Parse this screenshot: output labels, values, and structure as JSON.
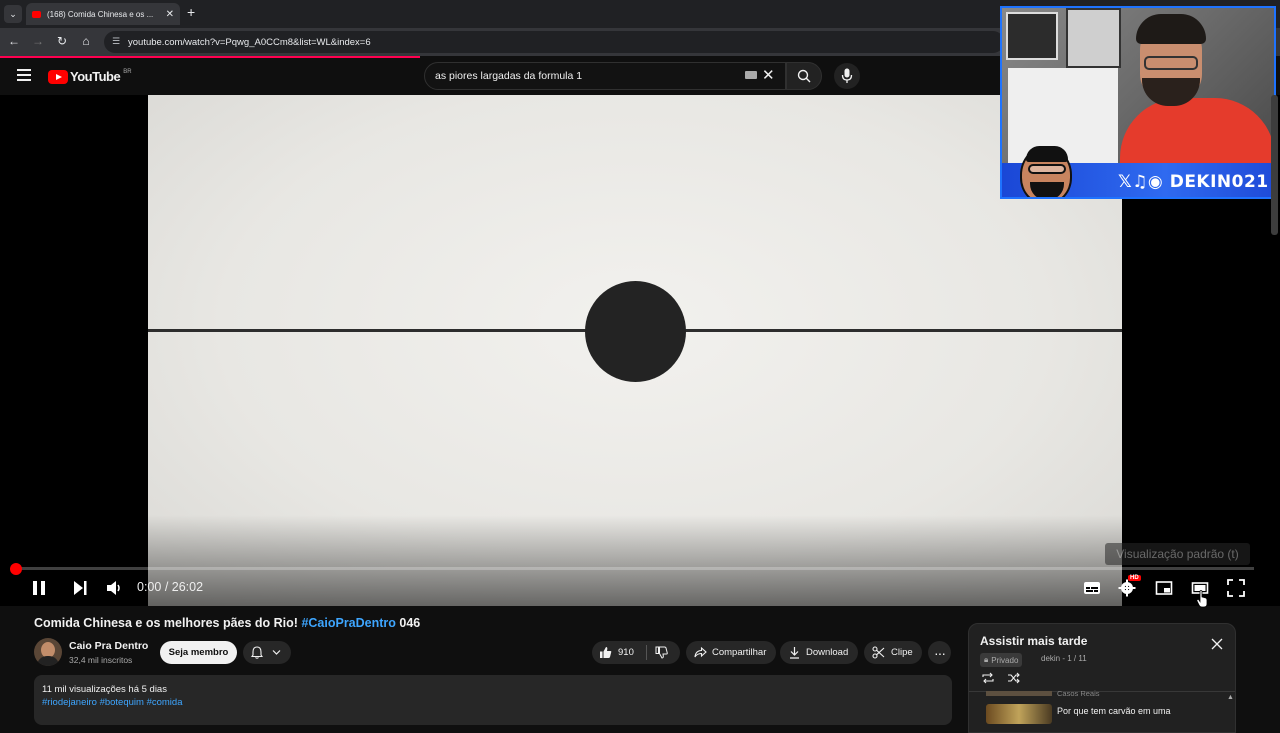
{
  "browser": {
    "tab_title": "(168) Comida Chinesa e os ...",
    "url": "youtube.com/watch?v=Pqwg_A0CCm8&list=WL&index=6"
  },
  "youtube": {
    "logo_text": "YouTube",
    "region": "BR",
    "search_value": "as piores largadas da formula 1"
  },
  "player": {
    "time_current": "0:00",
    "time_sep": " / ",
    "time_total": "26:02",
    "progress_fraction": 0.0,
    "tooltip": "Visualização padrão (t)",
    "hd_badge": "HD"
  },
  "overlay": {
    "handle": "DEKIN021"
  },
  "video": {
    "title_main": "Comida Chinesa e os melhores pães do Rio! ",
    "title_tag": "#CaioPraDentro",
    "title_suffix": " 046",
    "channel_name": "Caio Pra Dentro",
    "subscribers": "32,4 mil inscritos",
    "member_button": "Seja membro",
    "likes": "910",
    "share_label": "Compartilhar",
    "download_label": "Download",
    "clip_label": "Clipe",
    "views_date": "11 mil visualizações  há 5 dias",
    "hashtags": "#riodejaneiro #botequim #comida"
  },
  "playlist": {
    "title": "Assistir mais tarde",
    "privacy": "Privado",
    "meta": "dekin - 1 / 11",
    "prev_item": "Casos Reais",
    "item_title": "Por que tem carvão em uma"
  },
  "colors": {
    "accent_red": "#ff0000",
    "link_blue": "#3ea6ff",
    "overlay_border": "#1e73ff"
  }
}
